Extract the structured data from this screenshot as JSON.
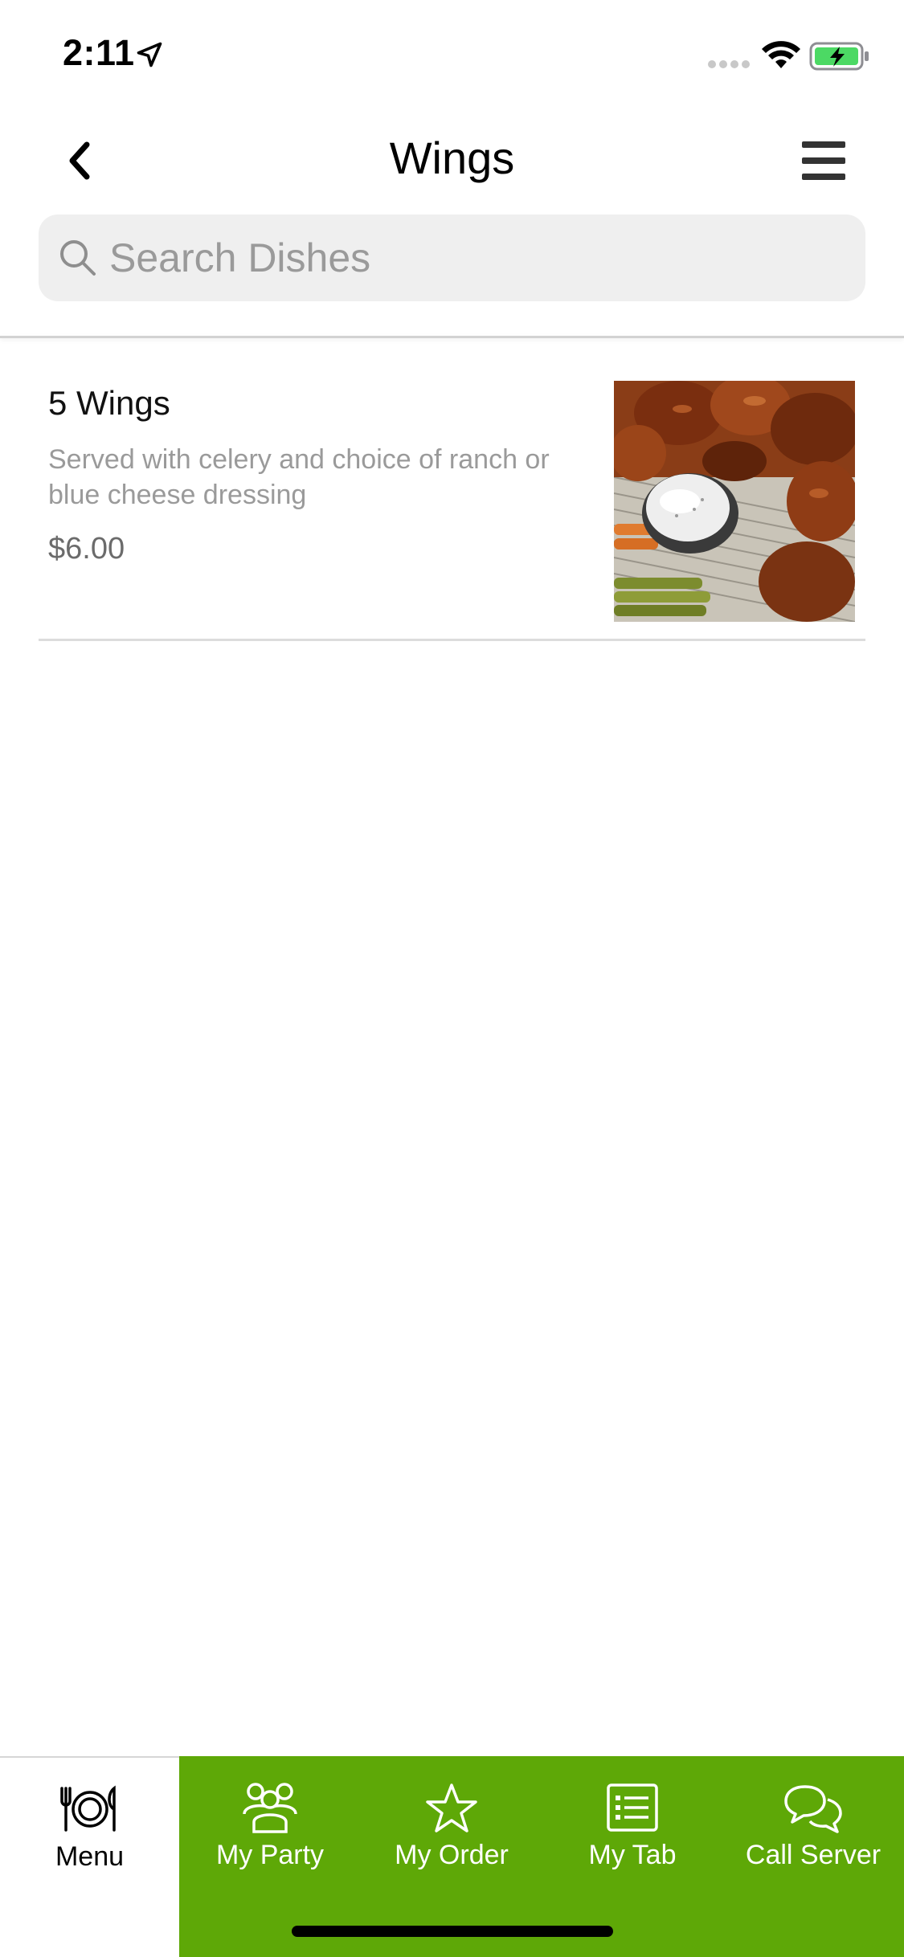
{
  "status_bar": {
    "time": "2:11",
    "location_icon": "location-arrow-icon",
    "signal_icon": "cellular-signal-icon",
    "wifi_icon": "wifi-icon",
    "battery_icon": "battery-charging-icon",
    "battery_color": "#4cd964"
  },
  "header": {
    "title": "Wings",
    "back_icon": "chevron-left-icon",
    "menu_icon": "hamburger-menu-icon"
  },
  "search": {
    "placeholder": "Search Dishes",
    "value": "",
    "icon": "search-icon"
  },
  "dishes": [
    {
      "name": "5 Wings",
      "description": "Served with celery and choice of ranch or blue cheese dressing",
      "price": "$6.00",
      "image": "chicken-wings-photo"
    }
  ],
  "tabs": [
    {
      "label": "Menu",
      "icon": "plate-fork-knife-icon",
      "active": true
    },
    {
      "label": "My Party",
      "icon": "group-people-icon",
      "active": false
    },
    {
      "label": "My Order",
      "icon": "star-icon",
      "active": false
    },
    {
      "label": "My Tab",
      "icon": "list-receipt-icon",
      "active": false
    },
    {
      "label": "Call Server",
      "icon": "chat-bubbles-icon",
      "active": false
    }
  ],
  "colors": {
    "accent": "#5ea807",
    "search_bg": "#efefef",
    "muted_text": "#9a9a9a"
  }
}
